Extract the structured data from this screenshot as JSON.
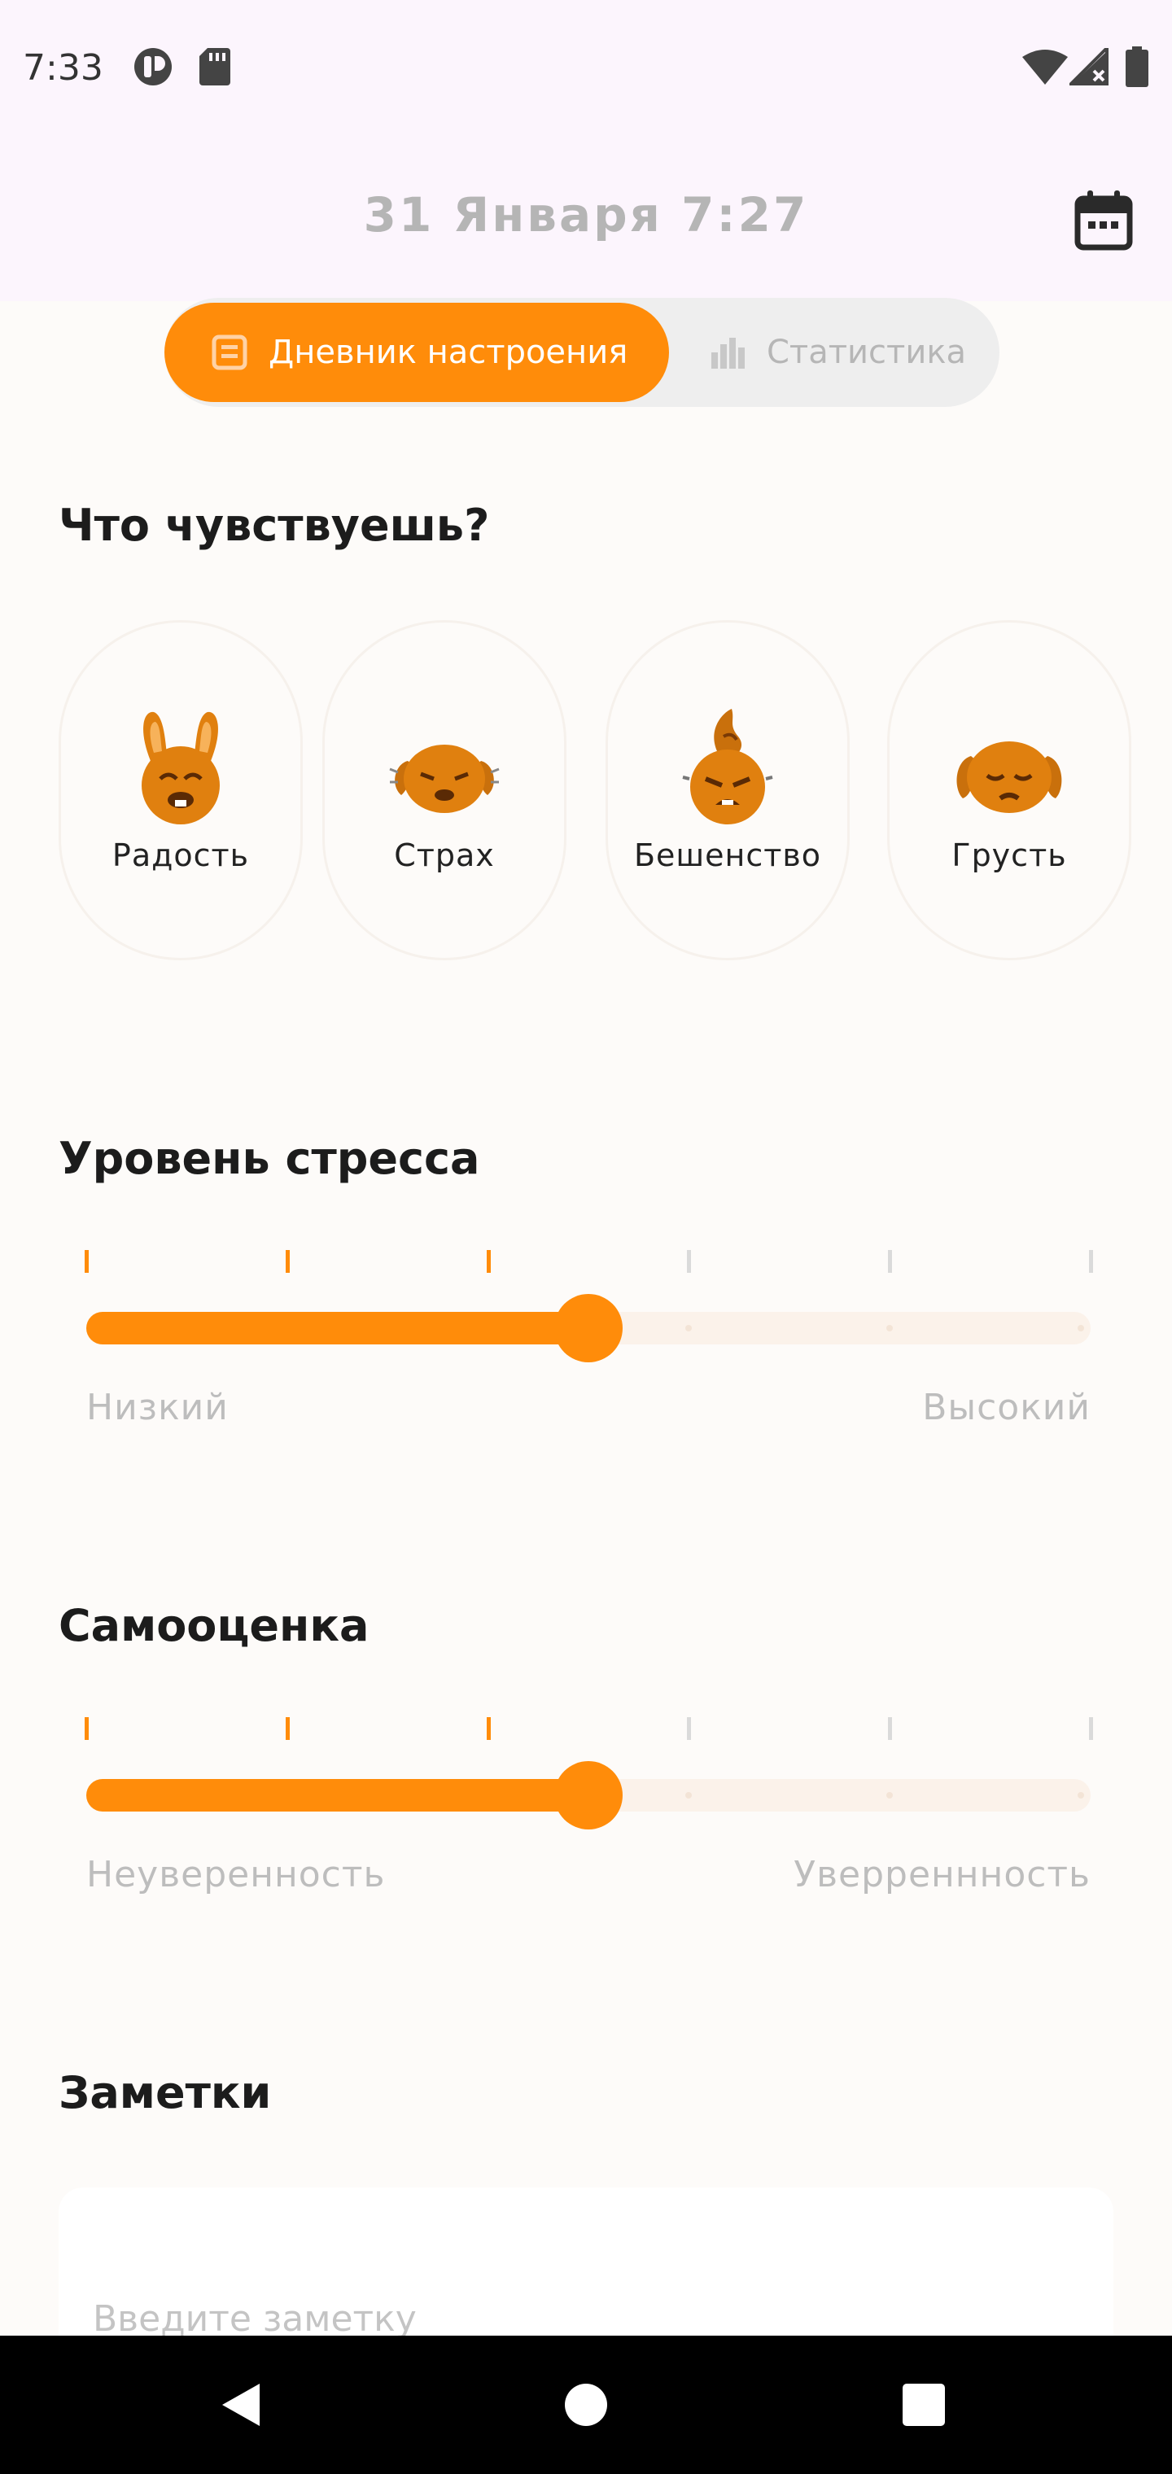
{
  "status_bar": {
    "time": "7:33",
    "icons": [
      "tracking-app-icon",
      "sd-card-icon",
      "wifi-icon",
      "no-signal-icon",
      "battery-icon"
    ]
  },
  "header": {
    "title": "31 Января 7:27",
    "calendar_icon": "calendar-icon"
  },
  "tabs": [
    {
      "label": "Дневник настроения",
      "icon": "diary-icon",
      "active": true
    },
    {
      "label": "Статистика",
      "icon": "bar-chart-icon",
      "active": false
    }
  ],
  "emotions": {
    "title": "Что чувствуешь?",
    "items": [
      {
        "label": "Радость",
        "icon": "joy-bunny-icon"
      },
      {
        "label": "Страх",
        "icon": "fear-bunny-icon"
      },
      {
        "label": "Бешенство",
        "icon": "rage-bunny-icon"
      },
      {
        "label": "Грусть",
        "icon": "sad-bunny-icon"
      }
    ]
  },
  "stress": {
    "title": "Уровень стресса",
    "min_label": "Низкий",
    "max_label": "Высокий",
    "value_fraction": 0.5,
    "steps": 5
  },
  "self_esteem": {
    "title": "Самооценка",
    "min_label": "Неуверенность",
    "max_label": "Уверреннность",
    "value_fraction": 0.5,
    "steps": 5
  },
  "notes": {
    "title": "Заметки",
    "placeholder": "Введите заметку",
    "value": ""
  },
  "nav": {
    "icons": [
      "back-icon",
      "home-icon",
      "recents-icon"
    ]
  },
  "colors": {
    "accent": "#FF8C0A",
    "background": "#FDFBF9",
    "header_bg": "#FCF5FD",
    "muted": "#BDBDBD"
  }
}
